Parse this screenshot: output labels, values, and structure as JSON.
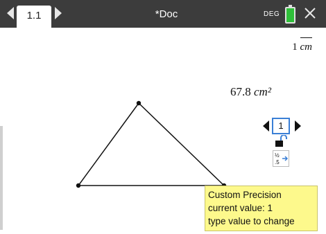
{
  "header": {
    "tab_label": "1.1",
    "doc_title": "*Doc",
    "angle_mode": "DEG"
  },
  "canvas": {
    "scale": {
      "value": "1",
      "unit": "cm"
    },
    "area": {
      "value": "67.8",
      "unit": "cm²"
    }
  },
  "precision_control": {
    "value": "1"
  },
  "tooltip": {
    "line1": "Custom Precision",
    "line2": "current value: 1",
    "line3": "type value to change"
  },
  "colors": {
    "topbar": "#3c3c3c",
    "accent": "#3a7fd6",
    "battery": "#2fbf3a",
    "tooltip": "#fdf98c"
  }
}
